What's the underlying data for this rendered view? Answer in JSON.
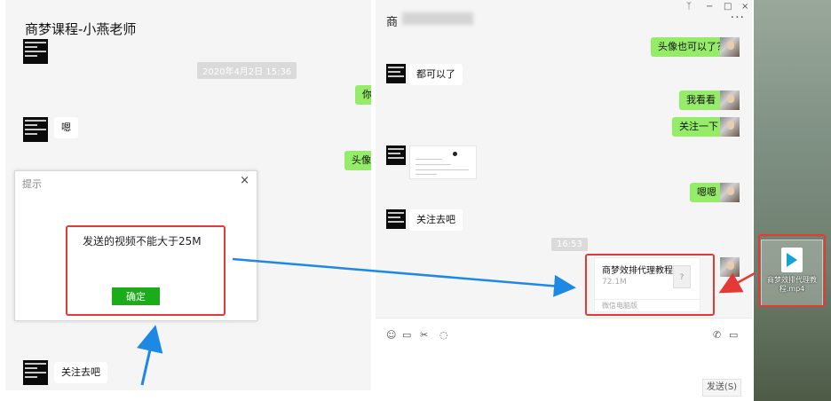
{
  "left_window": {
    "title": "商梦课程-小燕老师",
    "timestamp": "2020年4月2日 15:36",
    "messages": [
      {
        "side": "right",
        "text": "你"
      },
      {
        "side": "left",
        "text": "嗯"
      },
      {
        "side": "right",
        "text": "头像"
      },
      {
        "side": "left",
        "text": "关注去吧"
      }
    ]
  },
  "dialog": {
    "title": "提示",
    "close": "×",
    "message": "发送的视频不能大于25M",
    "ok_label": "确定"
  },
  "right_window": {
    "title": "商",
    "window_controls": {
      "pin": "ᛉ",
      "minimize": "−",
      "maximize": "□",
      "close": "×"
    },
    "more": "···",
    "messages": [
      {
        "side": "right",
        "text": "头像也可以了？"
      },
      {
        "side": "left",
        "text": "都可以了"
      },
      {
        "side": "right",
        "text": "我看看"
      },
      {
        "side": "right",
        "text": "关注一下"
      },
      {
        "side": "right",
        "text": "嗯嗯"
      },
      {
        "side": "left",
        "text": "关注去吧"
      }
    ],
    "timestamp": "16:53",
    "file_card": {
      "name": "商梦效排代理教程...",
      "size": "72.1M",
      "doc_glyph": "?",
      "footer": "微信电脑版"
    },
    "toolbar": {
      "emoji": "☺",
      "folder": "▭",
      "scissors": "✂",
      "chat": "◌",
      "phone": "✆",
      "video": "▭"
    },
    "send_label": "发送(S)"
  },
  "desktop": {
    "file_label": "商梦效排代理教程.mp4"
  },
  "colors": {
    "highlight": "#e53935",
    "arrow": "#1e88e5",
    "bubble_green": "#95ec69",
    "ok_button": "#1aad19"
  }
}
